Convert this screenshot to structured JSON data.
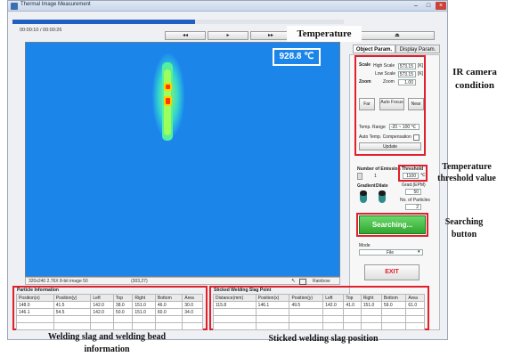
{
  "window": {
    "title": "Thermal Image Measurement"
  },
  "playback": {
    "current_time": "00:00:10",
    "separator": "/",
    "total_time": "00:00:26",
    "progress": 0.55,
    "rewind_label": "◂◂",
    "play_label": "▸",
    "forward_label": "▸▸",
    "eject_label": "⏏"
  },
  "tabs": [
    "Object Param.",
    "Display Param."
  ],
  "temperature_readout": "928.8 ℃",
  "scale": {
    "label": "Scale",
    "high_label": "High Scale",
    "high_value": "573.15",
    "high_unit": "[K]",
    "low_label": "Low Scale",
    "low_value": "573.15",
    "low_unit": "[K]",
    "zoom_label": "Zoom",
    "zoom_field_label": "Zoom",
    "zoom_value": "1.00"
  },
  "focus_buttons": [
    "Far",
    "Auto Focus",
    "Near"
  ],
  "temp_range": {
    "label": "Temp. Range",
    "value": "-20 ~ 100 ℃"
  },
  "auto_comp_label": "Auto Temp. Compensation",
  "update_label": "Update",
  "detection": {
    "num_emission_label": "Number of Emission",
    "num_emission_value": "1",
    "threshold_label": "Threshold",
    "threshold_value": "1100",
    "threshold_unit": "℃",
    "gradient_label": "Gradient",
    "dilate_label": "Dilate",
    "gradient_param_label": "Grad.(EPM)",
    "gradient_param_value": "50",
    "particles_label": "No. of Particles",
    "particles_value": "2"
  },
  "search_label": "Searching...",
  "mode": {
    "label": "Mode",
    "value": "File"
  },
  "exit_label": "EXIT",
  "status_bar": {
    "info": "320x240 2.76X 8-bit image 50",
    "coords": "(303,27)",
    "palette": "Rainbow"
  },
  "particle_info": {
    "title": "Particle Information",
    "columns": [
      "Position(x)",
      "Position(y)",
      "Left",
      "Top",
      "Right",
      "Bottom",
      "Area"
    ],
    "rows": [
      [
        "148.0",
        "41.5",
        "142.0",
        "38.0",
        "151.0",
        "46.0",
        "30.0"
      ],
      [
        "146.1",
        "54.5",
        "142.0",
        "50.0",
        "151.0",
        "60.0",
        "34.0"
      ]
    ]
  },
  "slag_points": {
    "title": "Sticked Welding Slag Point",
    "columns": [
      "Distance(mm)",
      "Position(x)",
      "Position(y)",
      "Left",
      "Top",
      "Right",
      "Bottom",
      "Area"
    ],
    "rows": [
      [
        "115.8",
        "146.1",
        "49.5",
        "142.0",
        "41.0",
        "151.0",
        "59.0",
        "61.0"
      ]
    ]
  },
  "annotations": {
    "temperature": "Temperature",
    "ir_camera": "IR camera condition",
    "threshold": "Temperature threshold value",
    "searching": "Searching button",
    "welding_info": "Welding slag and welding bead information",
    "slag_position": "Sticked welding slag position"
  },
  "colors": {
    "red_highlight": "#e0202a",
    "search_green": "#3fbf3f",
    "ir_background": "#1c8cf0",
    "progress": "#1f5fc4"
  }
}
